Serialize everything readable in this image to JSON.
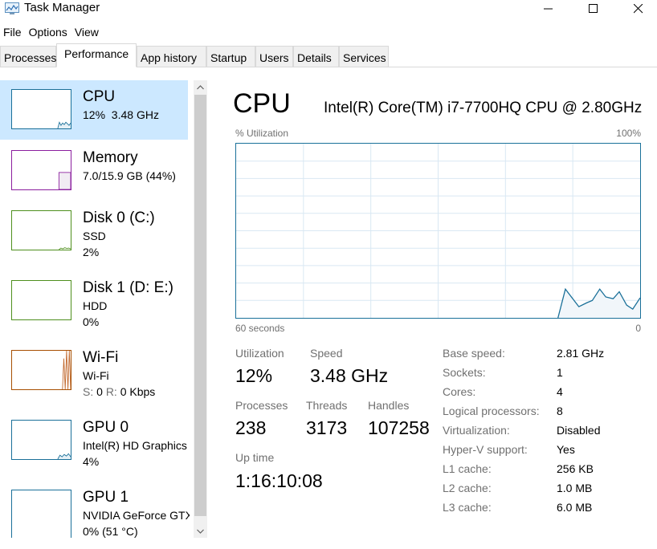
{
  "window": {
    "title": "Task Manager",
    "icon": "task-manager-icon",
    "controls": [
      "minimize",
      "maximize",
      "close"
    ]
  },
  "menu": [
    "File",
    "Options",
    "View"
  ],
  "tabs": [
    {
      "label": "Processes",
      "active": false
    },
    {
      "label": "Performance",
      "active": true
    },
    {
      "label": "App history",
      "active": false
    },
    {
      "label": "Startup",
      "active": false
    },
    {
      "label": "Users",
      "active": false
    },
    {
      "label": "Details",
      "active": false
    },
    {
      "label": "Services",
      "active": false
    }
  ],
  "sidebar": {
    "items": [
      {
        "title": "CPU",
        "sub1": "12%  3.48 GHz",
        "sub2": "",
        "color": "#1a7099",
        "selected": true
      },
      {
        "title": "Memory",
        "sub1": "7.0/15.9 GB (44%)",
        "sub2": "",
        "color": "#8b1e9e",
        "selected": false
      },
      {
        "title": "Disk 0 (C:)",
        "sub1": "SSD",
        "sub2": "2%",
        "color": "#4e8f1d",
        "selected": false
      },
      {
        "title": "Disk 1 (D: E:)",
        "sub1": "HDD",
        "sub2": "0%",
        "color": "#4e8f1d",
        "selected": false
      },
      {
        "title": "Wi-Fi",
        "sub1": "Wi-Fi",
        "sub2_send_label": "S:",
        "sub2_send_value": "0",
        "sub2_recv_label": "R:",
        "sub2_recv_value": "0 Kbps",
        "color": "#a74f01",
        "selected": false
      },
      {
        "title": "GPU 0",
        "sub1": "Intel(R) HD Graphics",
        "sub2": "4%",
        "color": "#1a7099",
        "selected": false
      },
      {
        "title": "GPU 1",
        "sub1": "NVIDIA GeForce GTX",
        "sub2": "0% (51 °C)",
        "color": "#1a7099",
        "selected": false
      }
    ]
  },
  "main": {
    "title": "CPU",
    "model": "Intel(R) Core(TM) i7-7700HQ CPU @ 2.80GHz",
    "graph_label": "% Utilization",
    "graph_max": "100%",
    "axis_left": "60 seconds",
    "axis_right": "0",
    "stats": {
      "utilization_label": "Utilization",
      "utilization_value": "12%",
      "speed_label": "Speed",
      "speed_value": "3.48 GHz",
      "processes_label": "Processes",
      "processes_value": "238",
      "threads_label": "Threads",
      "threads_value": "3173",
      "handles_label": "Handles",
      "handles_value": "107258",
      "uptime_label": "Up time",
      "uptime_value": "1:16:10:08"
    },
    "specs": [
      {
        "label": "Base speed:",
        "value": "2.81 GHz"
      },
      {
        "label": "Sockets:",
        "value": "1"
      },
      {
        "label": "Cores:",
        "value": "4"
      },
      {
        "label": "Logical processors:",
        "value": "8"
      },
      {
        "label": "Virtualization:",
        "value": "Disabled"
      },
      {
        "label": "Hyper-V support:",
        "value": "Yes"
      },
      {
        "label": "L1 cache:",
        "value": "256 KB"
      },
      {
        "label": "L2 cache:",
        "value": "1.0 MB"
      },
      {
        "label": "L3 cache:",
        "value": "6.0 MB"
      }
    ]
  },
  "chart_data": {
    "type": "area",
    "title": "CPU % Utilization",
    "xlabel": "60 seconds",
    "ylabel": "% Utilization",
    "xlim": [
      60,
      0
    ],
    "ylim": [
      0,
      100
    ],
    "grid": true,
    "grid_rows": 10,
    "grid_cols": 6,
    "x_seconds_ago": [
      12.2,
      11.1,
      9.1,
      7.9,
      7.1,
      6.0,
      5.1,
      4.0,
      3.1,
      2.0,
      1.1,
      0
    ],
    "values": [
      0,
      16.5,
      6.4,
      8.7,
      10,
      16.5,
      12,
      11,
      15,
      7.3,
      5,
      11.5
    ],
    "line_color": "#1a7099",
    "fill_color": "#f1f6fa"
  },
  "thumbnails": {
    "cpu": [
      0,
      40,
      20,
      35,
      25,
      40,
      30,
      20,
      35
    ],
    "memory_percent": 44,
    "disk0": [
      0,
      4,
      2,
      5,
      3,
      4,
      2
    ],
    "wifi": [
      0,
      80,
      0,
      100,
      0,
      100,
      0
    ],
    "gpu0": [
      0,
      10,
      6,
      12,
      8,
      14,
      6
    ]
  },
  "scrollbar": {
    "up": "chevron-up",
    "down": "chevron-down"
  }
}
